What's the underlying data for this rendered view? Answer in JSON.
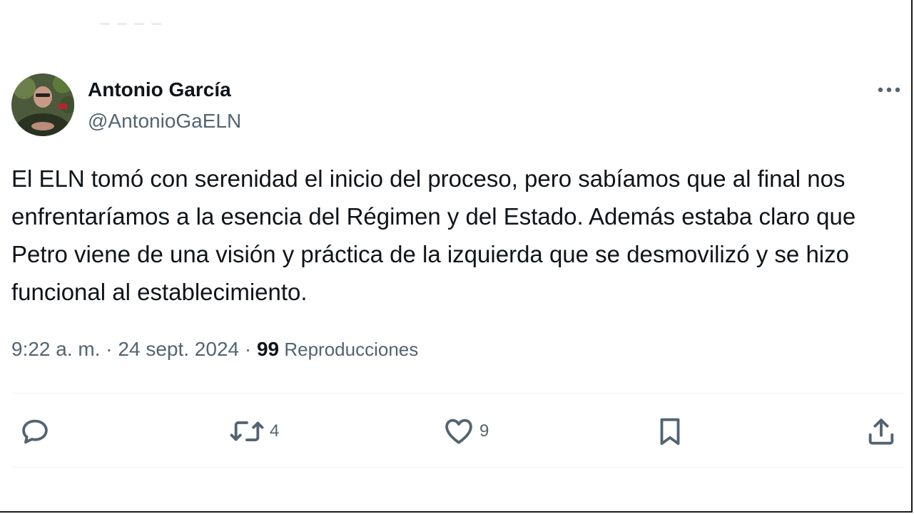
{
  "tweet": {
    "author_name": "Antonio García",
    "author_handle": "@AntonioGaELN",
    "text": "El ELN tomó con serenidad el inicio del proceso, pero sabíamos que al final nos enfrentaríamos a la esencia del Régimen y del Estado. Además estaba claro que Petro viene de una visión y práctica de la izquierda que se desmovilizó y se hizo funcional al establecimiento.",
    "timestamp": "9:22 a. m. · 24 sept. 2024 · ",
    "views_count": "99",
    "views_label": " Reproducciones"
  },
  "actions": {
    "reply_icon": "reply-icon",
    "retweet_icon": "retweet-icon",
    "retweet_count": "4",
    "like_icon": "heart-icon",
    "like_count": "9",
    "bookmark_icon": "bookmark-icon",
    "share_icon": "share-icon"
  },
  "colors": {
    "text_primary": "#0f1419",
    "text_secondary": "#536471",
    "divider": "#eff3f4"
  }
}
